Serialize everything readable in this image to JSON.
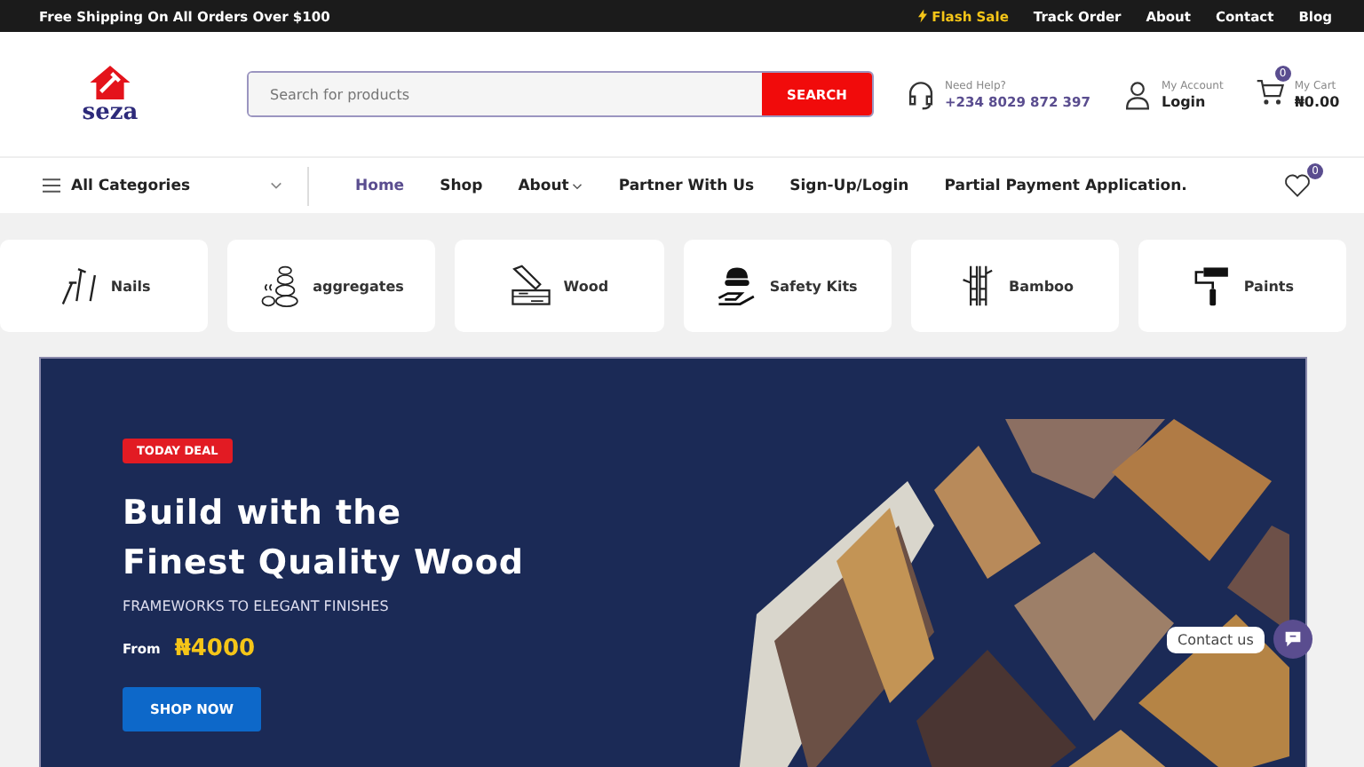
{
  "top_bar": {
    "promo": "Free Shipping On All Orders Over $100",
    "links": [
      {
        "label": "Flash Sale",
        "kind": "flash"
      },
      {
        "label": "Track Order",
        "kind": "plain"
      },
      {
        "label": "About",
        "kind": "plain"
      },
      {
        "label": "Contact",
        "kind": "plain"
      },
      {
        "label": "Blog",
        "kind": "plain"
      }
    ]
  },
  "header": {
    "logo": "seza",
    "search": {
      "placeholder": "Search for products",
      "button": "SEARCH"
    },
    "help": {
      "label": "Need Help?",
      "phone": "+234 8029 872 397"
    },
    "account": {
      "label": "My Account",
      "action": "Login"
    },
    "cart": {
      "label": "My Cart",
      "total": "₦0.00",
      "count": "0"
    }
  },
  "nav": {
    "categories": "All Categories",
    "items": [
      {
        "label": "Home",
        "selected": true,
        "dropdown": false
      },
      {
        "label": "Shop",
        "selected": false,
        "dropdown": false
      },
      {
        "label": "About",
        "selected": false,
        "dropdown": true
      },
      {
        "label": "Partner With Us",
        "selected": false,
        "dropdown": false
      },
      {
        "label": "Sign-Up/Login",
        "selected": false,
        "dropdown": false
      },
      {
        "label": "Partial Payment Application.",
        "selected": false,
        "dropdown": false
      }
    ],
    "wishlist_count": "0"
  },
  "categories": [
    {
      "label": "Nails",
      "kind": "nails"
    },
    {
      "label": "aggregates",
      "kind": "stones"
    },
    {
      "label": "Wood",
      "kind": "wood"
    },
    {
      "label": "Safety Kits",
      "kind": "safety"
    },
    {
      "label": "Bamboo",
      "kind": "bamboo"
    },
    {
      "label": "Paints",
      "kind": "paint"
    }
  ],
  "hero": {
    "badge": "TODAY DEAL",
    "title_lines": [
      "Build with the",
      "Finest Quality Wood"
    ],
    "subtitle": "FRAMEWORKS TO ELEGANT FINISHES",
    "price_label": "From",
    "price": "₦4000",
    "button": "SHOP NOW"
  },
  "chat": {
    "label": "Contact us"
  }
}
